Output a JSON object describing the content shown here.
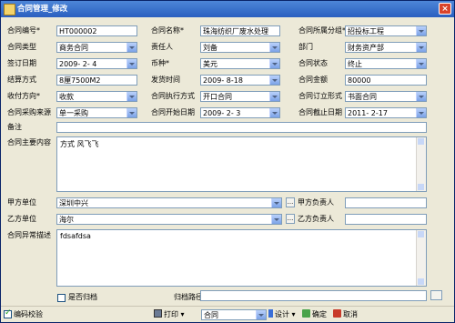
{
  "window": {
    "title": "合同管理_修改",
    "close": "×"
  },
  "fields": {
    "contract_no": {
      "label": "合同编号*",
      "value": "HT000002"
    },
    "contract_name": {
      "label": "合同名称*",
      "value": "珠海纺织厂废水处理"
    },
    "category": {
      "label": "合同所属分组*",
      "value": "招投标工程"
    },
    "contract_type": {
      "label": "合同类型",
      "value": "商务合同"
    },
    "responsible": {
      "label": "责任人",
      "value": "刘备"
    },
    "department": {
      "label": "部门",
      "value": "财务资产部"
    },
    "sign_date": {
      "label": "签订日期",
      "value": "2009- 2- 4"
    },
    "currency": {
      "label": "币种*",
      "value": "美元"
    },
    "status": {
      "label": "合同状态",
      "value": "终止"
    },
    "settle_method": {
      "label": "结算方式",
      "value": "8厘7500M2"
    },
    "send_time": {
      "label": "发货时间",
      "value": "2009- 8-18"
    },
    "amount": {
      "label": "合同金额",
      "value": "80000"
    },
    "payment_direction": {
      "label": "收付方向*",
      "value": "收款"
    },
    "exec_method": {
      "label": "合同执行方式",
      "value": "开口合同"
    },
    "sign_form": {
      "label": "合同订立形式",
      "value": "书面合同"
    },
    "purchase_source": {
      "label": "合同采购来源",
      "value": "单一采购"
    },
    "start_date": {
      "label": "合同开始日期",
      "value": "2009- 2- 3"
    },
    "end_date": {
      "label": "合同截止日期",
      "value": "2011- 2-17"
    },
    "remarks": {
      "label": "备注",
      "value": ""
    },
    "main_content": {
      "label": "合同主要内容",
      "value": "方式 风飞飞"
    },
    "party_a": {
      "label": "甲方单位",
      "value": "深圳中兴"
    },
    "party_a_contact": {
      "label": "甲方负责人",
      "value": ""
    },
    "party_b": {
      "label": "乙方单位",
      "value": "海尔"
    },
    "party_b_contact": {
      "label": "乙方负责人",
      "value": ""
    },
    "abnormal_desc": {
      "label": "合同异常描述",
      "value": "fdsafdsa"
    },
    "archived": {
      "label": "是否归档",
      "checked": false
    },
    "archive_path": {
      "label": "归档路径",
      "value": ""
    }
  },
  "toolbar": {
    "code_check": {
      "label": "编码校验",
      "checked": true
    },
    "print": "打印",
    "template": "合同",
    "design": "设计",
    "confirm": "确定",
    "cancel": "取消"
  },
  "ellipsis": "..."
}
